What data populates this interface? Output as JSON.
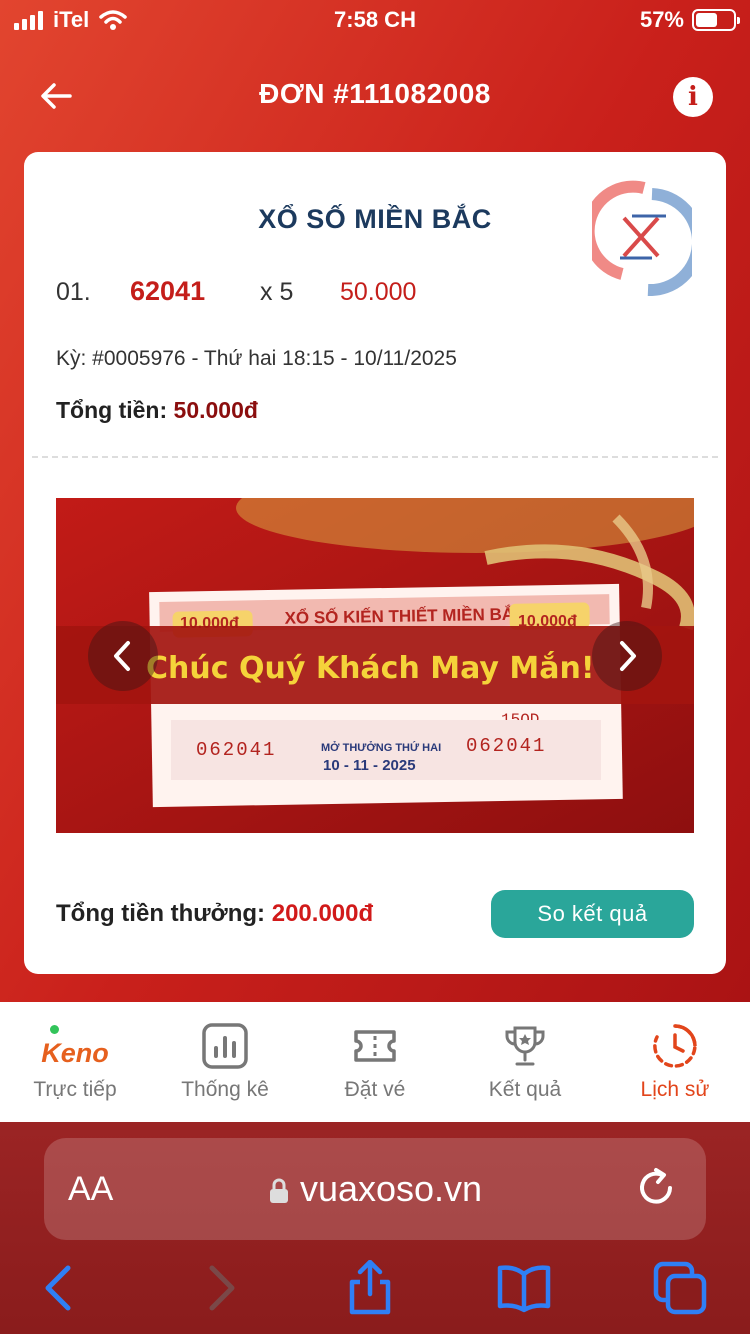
{
  "status_bar": {
    "carrier": "iTel",
    "time": "7:58 CH",
    "battery": "57%",
    "battery_level": 0.57
  },
  "header": {
    "title": "ĐƠN #111082008"
  },
  "order": {
    "lottery_name": "XỔ SỐ MIỀN BẮC",
    "ticket": {
      "index": "01.",
      "number": "62041",
      "multiplier": "x 5",
      "amount": "50.000"
    },
    "period": "Kỳ: #0005976 - Thứ hai 18:15 - 10/11/2025",
    "total_label": "Tổng tiền:",
    "total_value": "50.000đ",
    "photo": {
      "banner_text": "Chúc Quý Khách May Mắn!",
      "ticket_header": "XỔ SỐ KIẾN THIẾT MIỀN BẮC",
      "denomination": "10.000đ",
      "series": "15QD",
      "ticket_code": "062041",
      "draw_label": "MỞ THƯỞNG THỨ HAI",
      "draw_date": "10 - 11 - 2025"
    },
    "prize_label": "Tổng tiền thưởng:",
    "prize_value": "200.000đ",
    "compare_button": "So kết quả"
  },
  "bottom_nav": {
    "items": [
      {
        "logo": "Keno",
        "label": "Trực tiếp",
        "icon": "keno-logo"
      },
      {
        "label": "Thống kê",
        "icon": "chart-icon"
      },
      {
        "label": "Đặt vé",
        "icon": "ticket-icon"
      },
      {
        "label": "Kết quả",
        "icon": "trophy-icon"
      },
      {
        "label": "Lịch sử",
        "icon": "history-icon"
      }
    ],
    "active": "Lịch sử"
  },
  "browser": {
    "aa": "AA",
    "url": "vuaxoso.vn"
  },
  "colors": {
    "primary_red": "#c41e1a",
    "teal": "#2aa69a",
    "nav_active": "#e2451b",
    "browser_blue": "#2f7ff5"
  }
}
